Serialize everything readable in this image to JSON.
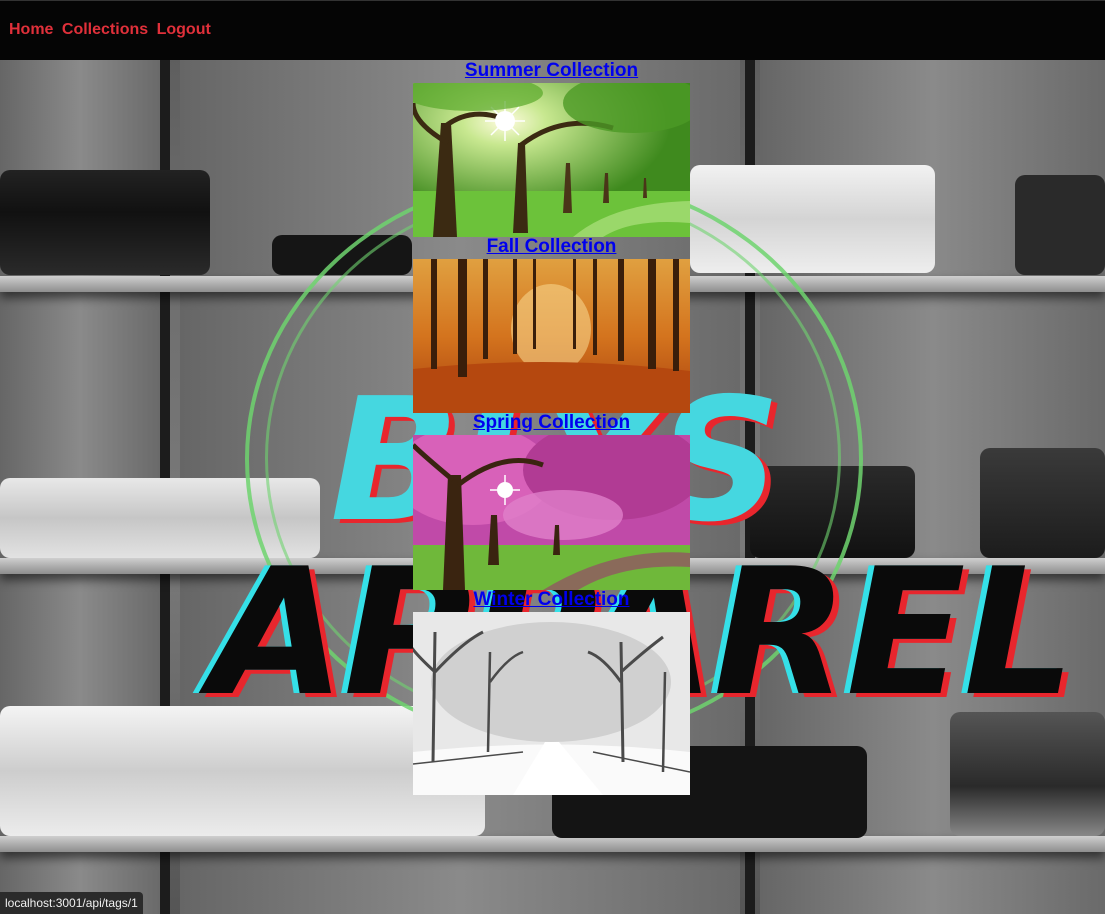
{
  "nav": {
    "home_label": "Home",
    "collections_label": "Collections",
    "logout_label": "Logout",
    "link_color": "#e0303a"
  },
  "background_logo": {
    "line1": "BLYS",
    "line2": "APPAREL"
  },
  "collections": [
    {
      "title": "Summer Collection",
      "image": "green-trees-sunlight"
    },
    {
      "title": "Fall Collection",
      "image": "orange-autumn-forest"
    },
    {
      "title": "Spring Collection",
      "image": "pink-cherry-blossom-trees"
    },
    {
      "title": "Winter Collection",
      "image": "snowy-park-path"
    }
  ],
  "status_bar": {
    "url": "localhost:3001/api/tags/1"
  },
  "colors": {
    "link": "#0000ee",
    "accent_cyan": "#35e0e8",
    "accent_red": "#e8262d"
  }
}
